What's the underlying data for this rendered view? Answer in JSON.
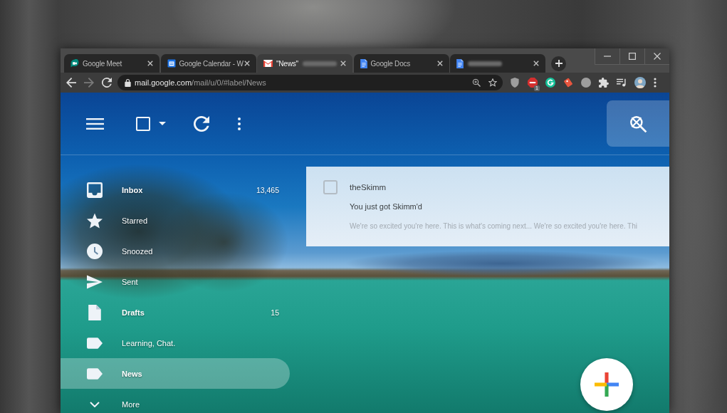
{
  "tabs": [
    {
      "title": "Google Meet",
      "kind": "meet",
      "blurred": false,
      "selected": false
    },
    {
      "title": "Google Calendar - W",
      "kind": "calendar",
      "blurred": false,
      "selected": false
    },
    {
      "title": "\"News\"",
      "kind": "mail",
      "blurred": true,
      "selected": true
    },
    {
      "title": "Google Docs",
      "kind": "docs",
      "blurred": false,
      "selected": false
    },
    {
      "kind": "docs",
      "blurred": true,
      "selected": false
    }
  ],
  "toolbar": {
    "nav": [
      {
        "kind": "back",
        "disabled": false
      },
      {
        "kind": "forward",
        "disabled": true
      },
      {
        "kind": "reload",
        "disabled": false
      }
    ],
    "address": {
      "host": "mail.google.com",
      "path": "/mail/u/0/#label/News"
    },
    "actions": [
      {
        "kind": "shield"
      },
      {
        "kind": "stop",
        "badge": "1"
      },
      {
        "kind": "grammar"
      },
      {
        "kind": "tag"
      },
      {
        "kind": "circle"
      },
      {
        "kind": "puzzle"
      },
      {
        "kind": "playlist"
      },
      {
        "kind": "avatar"
      },
      {
        "kind": "menu"
      }
    ]
  },
  "mail_toolbar": {
    "select_all": {
      "checked": false
    }
  },
  "sidebar": {
    "items": [
      {
        "label": "Inbox",
        "kind": "inbox",
        "count": "13,465",
        "unread": true,
        "selected": false
      },
      {
        "label": "Starred",
        "kind": "star",
        "unread": false,
        "selected": false
      },
      {
        "label": "Snoozed",
        "kind": "clock",
        "unread": false,
        "selected": false
      },
      {
        "label": "Sent",
        "kind": "send",
        "unread": false,
        "selected": false
      },
      {
        "label": "Drafts",
        "kind": "file",
        "count": "15",
        "unread": true,
        "selected": false
      },
      {
        "label": "Learning, Chat.",
        "kind": "label",
        "unread": false,
        "selected": false
      },
      {
        "label": "News",
        "kind": "label",
        "unread": true,
        "selected": true
      },
      {
        "label": "More",
        "kind": "more",
        "unread": false,
        "selected": false
      }
    ]
  },
  "emails": [
    {
      "sender": "theSkimm",
      "subject": "You just got Skimm'd",
      "snippet": "We're so excited you're here. This is what's coming next... We're so excited you're here. Thi",
      "checked": false
    }
  ]
}
